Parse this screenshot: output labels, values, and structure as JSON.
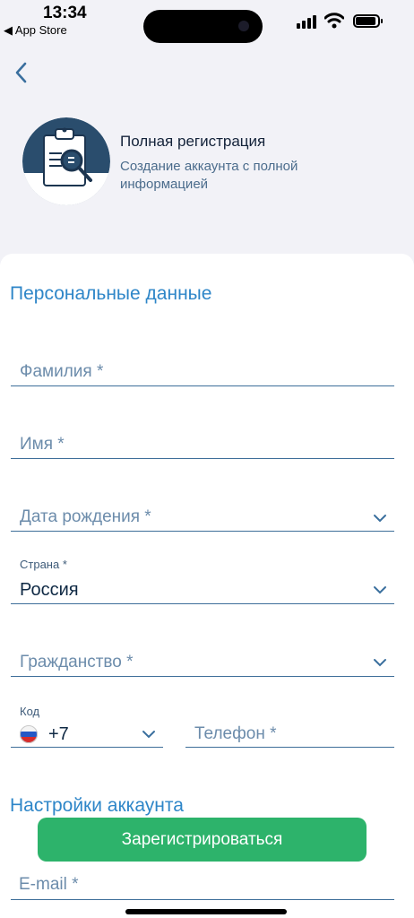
{
  "status": {
    "time": "13:34",
    "back_app": "◀ App Store"
  },
  "header": {
    "title": "Полная регистрация",
    "subtitle": "Создание аккаунта с полной информацией"
  },
  "sections": {
    "personal": "Персональные данные",
    "account": "Настройки аккаунта"
  },
  "fields": {
    "last_name": "Фамилия *",
    "first_name": "Имя *",
    "birth_date": "Дата рождения *",
    "country_label": "Страна *",
    "country_value": "Россия",
    "citizenship": "Гражданство *",
    "code_label": "Код",
    "code_value": "+7",
    "phone": "Телефон *",
    "email": "E-mail *"
  },
  "buttons": {
    "register": "Зарегистрироваться"
  },
  "colors": {
    "accent": "#2e86c8",
    "button": "#2db36b",
    "line": "#3d6e99"
  },
  "icons": [
    "back-chevron-icon",
    "clipboard-search-icon",
    "chevron-down-icon",
    "russia-flag-icon"
  ]
}
